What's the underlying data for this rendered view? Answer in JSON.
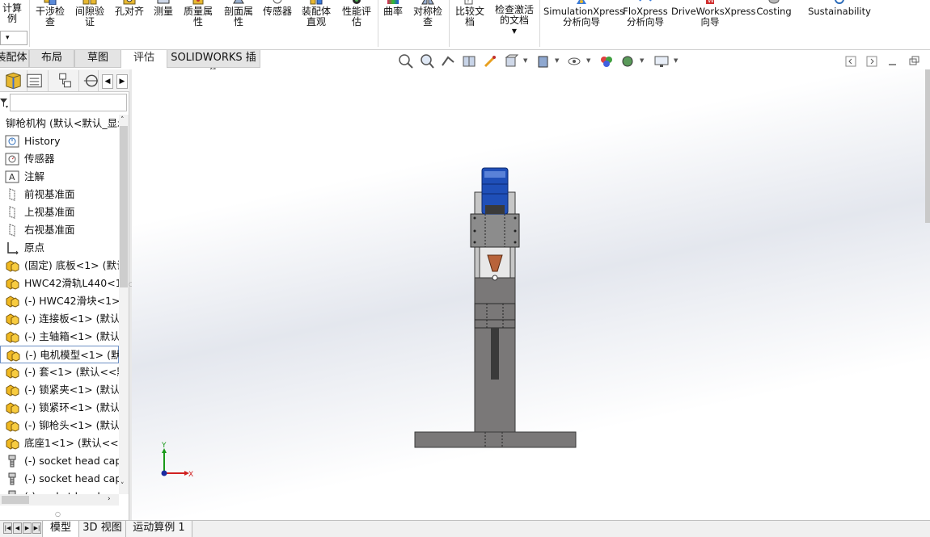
{
  "ribbon": {
    "calc_label": "计算例",
    "calc_dropdown": "▾",
    "buttons": [
      {
        "label": "干涉检查",
        "icon": "interference-check-icon"
      },
      {
        "label": "间隙验证",
        "icon": "clearance-verify-icon"
      },
      {
        "label": "孔对齐",
        "icon": "hole-alignment-icon"
      },
      {
        "label": "测量",
        "icon": "measure-icon"
      },
      {
        "label": "质量属性",
        "icon": "mass-properties-icon"
      },
      {
        "label": "剖面属性",
        "icon": "section-properties-icon"
      },
      {
        "label": "传感器",
        "icon": "sensor-icon"
      },
      {
        "label": "装配体直观",
        "icon": "assembly-visualization-icon"
      },
      {
        "label": "性能评估",
        "icon": "performance-evaluation-icon"
      },
      {
        "label": "曲率",
        "icon": "curvature-icon"
      },
      {
        "label": "对称检查",
        "icon": "symmetry-check-icon"
      },
      {
        "label": "比较文档",
        "icon": "compare-documents-icon"
      },
      {
        "label": "检查激活的文档",
        "icon": "check-active-document-icon"
      },
      {
        "label": "SimulationXpress 分析向导",
        "icon": "simulationxpress-icon"
      },
      {
        "label": "FloXpress 分析向导",
        "icon": "floxpress-icon"
      },
      {
        "label": "DriveWorksXpress 向导",
        "icon": "driveworksxpress-icon"
      },
      {
        "label": "Costing",
        "icon": "costing-icon"
      },
      {
        "label": "Sustainability",
        "icon": "sustainability-icon"
      }
    ]
  },
  "tabs": [
    "装配体",
    "布局",
    "草图",
    "评估",
    "SOLIDWORKS 插件"
  ],
  "tabs_active": "评估",
  "tree": {
    "root": "铆枪机构 (默认<默认_显示",
    "items": [
      {
        "label": "History",
        "icon": "history-icon"
      },
      {
        "label": "传感器",
        "icon": "sensor-folder-icon"
      },
      {
        "label": "注解",
        "icon": "annotation-icon"
      },
      {
        "label": "前视基准面",
        "icon": "plane-icon"
      },
      {
        "label": "上视基准面",
        "icon": "plane-icon"
      },
      {
        "label": "右视基准面",
        "icon": "plane-icon"
      },
      {
        "label": "原点",
        "icon": "origin-icon"
      },
      {
        "label": "(固定) 底板<1> (默认",
        "icon": "part-icon"
      },
      {
        "label": "HWC42滑轨L440<1>",
        "icon": "part-icon"
      },
      {
        "label": "(-) HWC42滑块<1> (",
        "icon": "part-icon"
      },
      {
        "label": "(-) 连接板<1> (默认<",
        "icon": "part-icon"
      },
      {
        "label": "(-) 主轴箱<1> (默认<",
        "icon": "part-icon"
      },
      {
        "label": "(-) 电机模型<1> (默认",
        "icon": "part-icon"
      },
      {
        "label": "(-) 套<1> (默认<<默",
        "icon": "part-icon"
      },
      {
        "label": "(-) 锁紧夹<1> (默认<",
        "icon": "part-icon"
      },
      {
        "label": "(-) 锁紧环<1> (默认<",
        "icon": "part-icon"
      },
      {
        "label": "(-) 铆枪头<1> (默认<",
        "icon": "part-icon"
      },
      {
        "label": "底座1<1> (默认<<默",
        "icon": "part-icon"
      },
      {
        "label": "(-) socket head cap",
        "icon": "screw-icon"
      },
      {
        "label": "(-) socket head cap",
        "icon": "screw-icon"
      },
      {
        "label": "(-) socket head cap",
        "icon": "screw-icon"
      }
    ]
  },
  "triad": {
    "x": "X",
    "y": "Y"
  },
  "bottom_tabs": [
    "模型",
    "3D 视图",
    "运动算例 1"
  ],
  "bottom_active": "模型",
  "colors": {
    "motor_blue": "#1f4fb8",
    "body_gray": "#7a7878",
    "selection": "#6c8fc4"
  }
}
